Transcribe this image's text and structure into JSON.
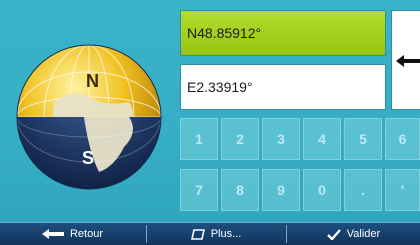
{
  "globe": {
    "north_label": "N",
    "south_label": "S"
  },
  "coordinates": {
    "latitude": "N48.85912°",
    "longitude": "E2.33919°"
  },
  "keypad": {
    "row1": [
      "1",
      "2",
      "3",
      "4",
      "5",
      "6"
    ],
    "row2": [
      "7",
      "8",
      "9",
      "0",
      ".",
      "'"
    ]
  },
  "bottom_bar": {
    "back_label": "Retour",
    "more_label": "Plus...",
    "confirm_label": "Valider"
  },
  "colors": {
    "background": "#3fb5ca",
    "active_field": "#a4cf1c",
    "bar": "#173f6a"
  }
}
